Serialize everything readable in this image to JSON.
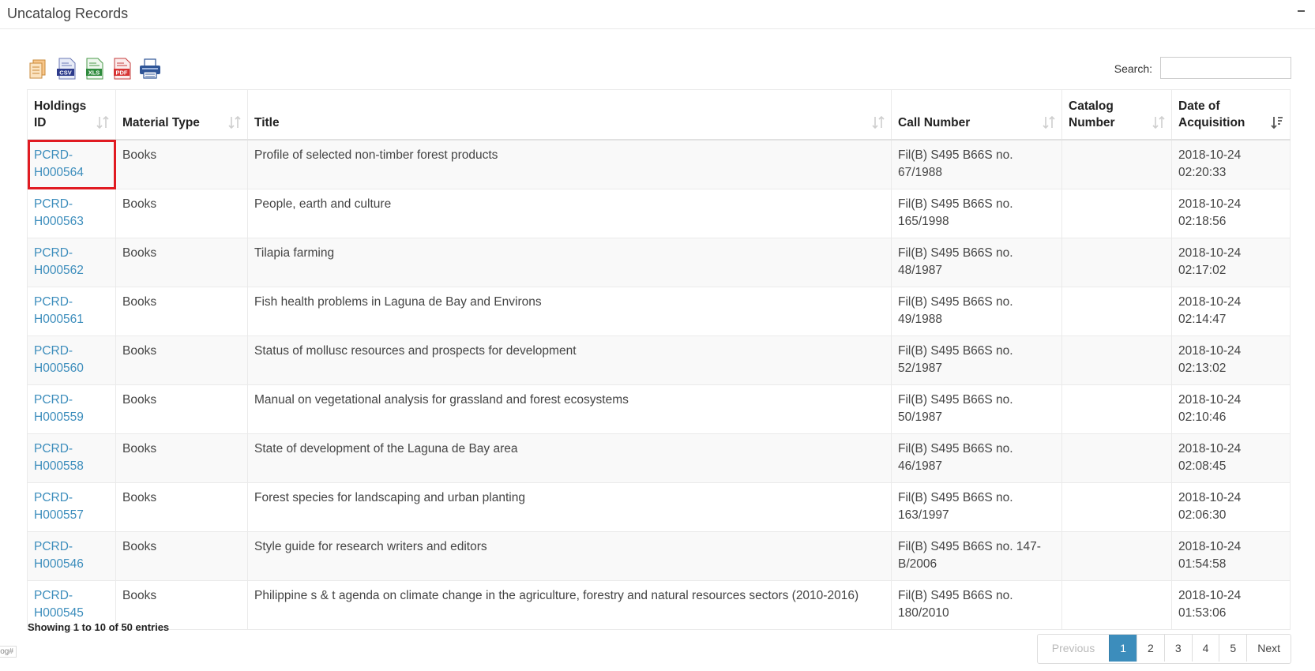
{
  "panel": {
    "title": "Uncatalog Records"
  },
  "toolbar": {
    "buttons": [
      {
        "name": "copy",
        "icon": "copy-icon"
      },
      {
        "name": "csv",
        "icon": "csv-icon",
        "label": "CSV"
      },
      {
        "name": "excel",
        "icon": "excel-icon",
        "label": "XLS"
      },
      {
        "name": "pdf",
        "icon": "pdf-icon",
        "label": "PDF"
      },
      {
        "name": "print",
        "icon": "print-icon"
      }
    ]
  },
  "search": {
    "label": "Search:",
    "value": ""
  },
  "table": {
    "columns": [
      "Holdings ID",
      "Material Type",
      "Title",
      "Call Number",
      "Catalog Number",
      "Date of Acquisition"
    ],
    "sorted_column": "Date of Acquisition",
    "sort_direction": "descending",
    "rows": [
      {
        "id": "PCRD-H000564",
        "type": "Books",
        "title": "Profile of selected non-timber forest products",
        "call": "Fil(B) S495 B66S no. 67/1988",
        "catalog": "",
        "date": "2018-10-24 02:20:33"
      },
      {
        "id": "PCRD-H000563",
        "type": "Books",
        "title": "People, earth and culture",
        "call": "Fil(B) S495 B66S no. 165/1998",
        "catalog": "",
        "date": "2018-10-24 02:18:56"
      },
      {
        "id": "PCRD-H000562",
        "type": "Books",
        "title": "Tilapia farming",
        "call": "Fil(B) S495 B66S no. 48/1987",
        "catalog": "",
        "date": "2018-10-24 02:17:02"
      },
      {
        "id": "PCRD-H000561",
        "type": "Books",
        "title": "Fish health problems in Laguna de Bay and Environs",
        "call": "Fil(B) S495 B66S no. 49/1988",
        "catalog": "",
        "date": "2018-10-24 02:14:47"
      },
      {
        "id": "PCRD-H000560",
        "type": "Books",
        "title": "Status of mollusc resources and prospects for development",
        "call": "Fil(B) S495 B66S no. 52/1987",
        "catalog": "",
        "date": "2018-10-24 02:13:02"
      },
      {
        "id": "PCRD-H000559",
        "type": "Books",
        "title": "Manual on vegetational analysis for grassland and forest ecosystems",
        "call": "Fil(B) S495 B66S no. 50/1987",
        "catalog": "",
        "date": "2018-10-24 02:10:46"
      },
      {
        "id": "PCRD-H000558",
        "type": "Books",
        "title": "State of development of the Laguna de Bay area",
        "call": "Fil(B) S495 B66S no. 46/1987",
        "catalog": "",
        "date": "2018-10-24 02:08:45"
      },
      {
        "id": "PCRD-H000557",
        "type": "Books",
        "title": "Forest species for landscaping and urban planting",
        "call": "Fil(B) S495 B66S no. 163/1997",
        "catalog": "",
        "date": "2018-10-24 02:06:30"
      },
      {
        "id": "PCRD-H000546",
        "type": "Books",
        "title": "Style guide for research writers and editors",
        "call": "Fil(B) S495 B66S no. 147-B/2006",
        "catalog": "",
        "date": "2018-10-24 01:54:58"
      },
      {
        "id": "PCRD-H000545",
        "type": "Books",
        "title": "Philippine s & t agenda on climate change in the agriculture, forestry and natural resources sectors (2010-2016)",
        "call": "Fil(B) S495 B66S no. 180/2010",
        "catalog": "",
        "date": "2018-10-24 01:53:06"
      }
    ]
  },
  "info": "Showing 1 to 10 of 50 entries",
  "pagination": {
    "previous": "Previous",
    "pages": [
      "1",
      "2",
      "3",
      "4",
      "5"
    ],
    "active": "1",
    "next": "Next"
  },
  "corner_text": "log#",
  "colors": {
    "link": "#3c8dbc",
    "active_page": "#3c8dbc",
    "highlight": "#e11b22",
    "stripe": "#f9f9f9"
  }
}
